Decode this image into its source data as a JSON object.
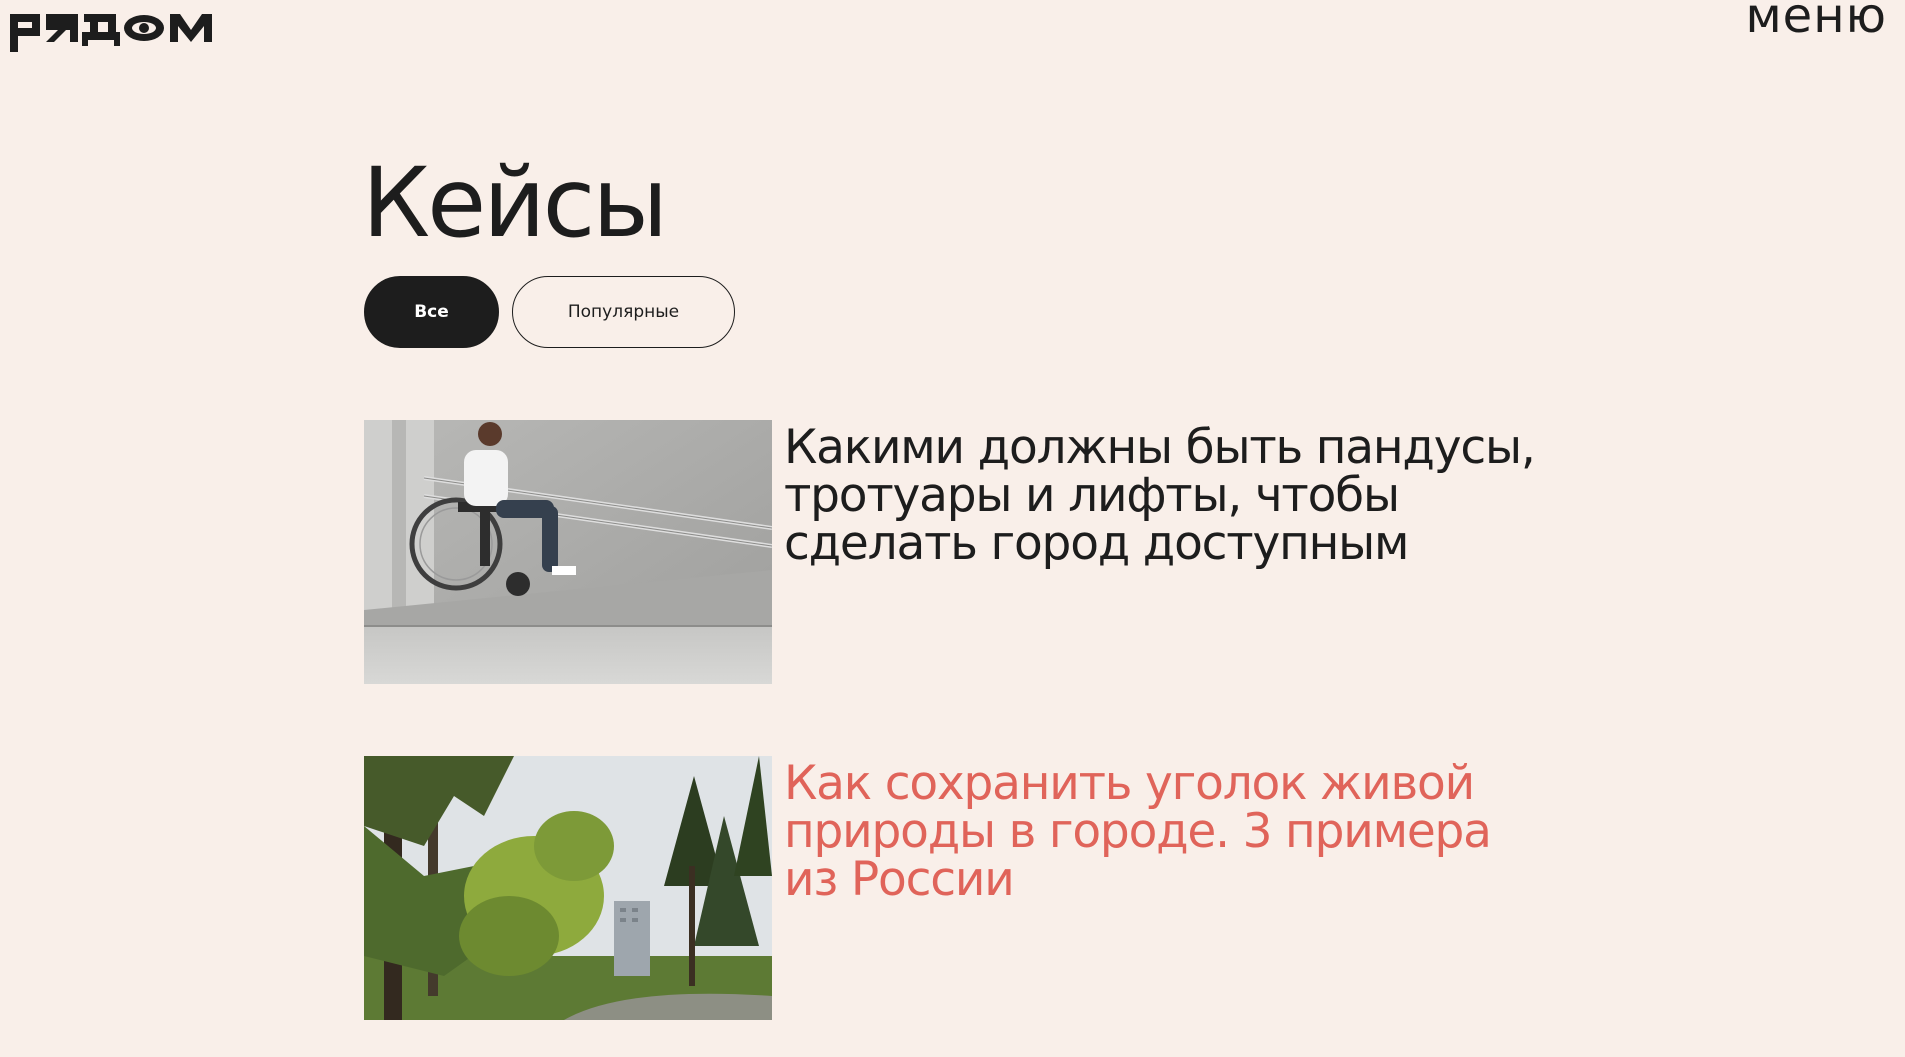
{
  "header": {
    "logo_text": "рядом",
    "menu_label": "меню"
  },
  "page": {
    "title": "Кейсы"
  },
  "filters": [
    {
      "label": "Все",
      "active": true
    },
    {
      "label": "Популярные",
      "active": false
    }
  ],
  "cards": [
    {
      "title": "Какими должны быть пандусы, тротуары и лифты, чтобы сделать город доступным",
      "image": "wheelchair-ramp-photo"
    },
    {
      "title": "Как сохранить уголок живой природы в городе. 3 примера из России",
      "image": "city-park-trees-photo"
    }
  ],
  "colors": {
    "background": "#f9efe9",
    "text": "#1d1d1d",
    "accent": "#e0645a"
  }
}
